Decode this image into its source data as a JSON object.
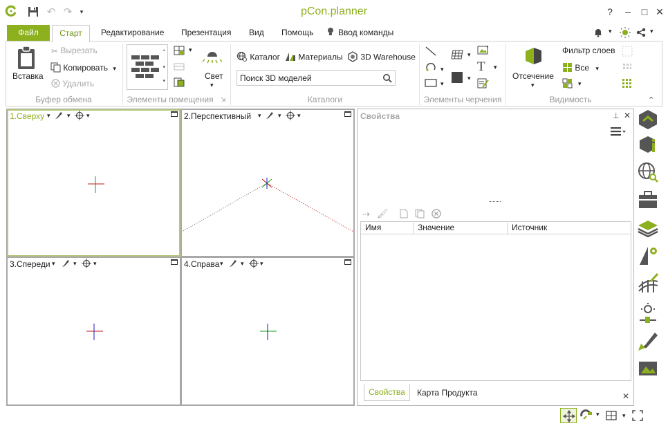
{
  "app": {
    "title": "pCon.planner"
  },
  "window": {
    "help": "?",
    "minimize": "–",
    "maximize": "□",
    "close": "✕"
  },
  "menu": {
    "tabs": [
      {
        "label": "Файл"
      },
      {
        "label": "Старт"
      },
      {
        "label": "Редактирование"
      },
      {
        "label": "Презентация"
      },
      {
        "label": "Вид"
      },
      {
        "label": "Помощь"
      },
      {
        "label": "Ввод команды"
      }
    ]
  },
  "ribbon": {
    "clipboard": {
      "paste": "Вставка",
      "cut": "Вырезать",
      "copy": "Копировать",
      "delete": "Удалить",
      "group_label": "Буфер обмена"
    },
    "room": {
      "light": "Свет",
      "group_label": "Элементы помещения"
    },
    "catalogs": {
      "catalog": "Каталог",
      "materials": "Материалы",
      "warehouse": "3D Warehouse",
      "search_placeholder": "Поиск 3D моделей",
      "group_label": "Каталоги"
    },
    "drawing": {
      "group_label": "Элементы черчения"
    },
    "visibility": {
      "clip": "Отсечение",
      "layer_filter": "Фильтр слоев",
      "all": "Все",
      "group_label": "Видимость"
    }
  },
  "viewports": [
    {
      "title": "1.Сверху"
    },
    {
      "title": "2.Перспективный"
    },
    {
      "title": "3.Спереди"
    },
    {
      "title": "4.Справа"
    }
  ],
  "properties": {
    "title": "Свойства",
    "columns": [
      "Имя",
      "Значение",
      "Источник"
    ],
    "bottom_tabs": [
      {
        "label": "Свойства"
      },
      {
        "label": "Карта Продукта"
      }
    ]
  },
  "colors": {
    "accent": "#8cb01e",
    "accent_dark": "#6f951a"
  }
}
